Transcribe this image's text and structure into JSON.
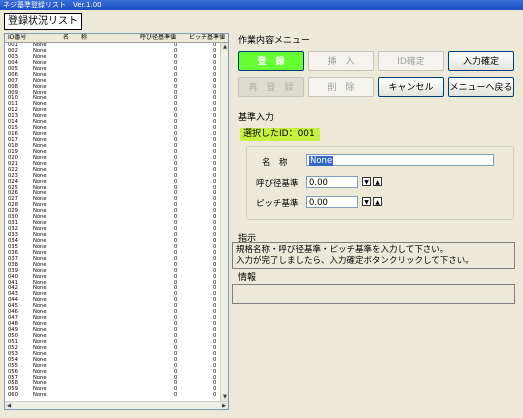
{
  "window": {
    "title": "ネジ基準登録リスト　Ver.1.00"
  },
  "list_panel": {
    "title": "登録状況リスト",
    "columns": [
      "ID番号",
      "名　　称",
      "呼び径基準値",
      "ピッチ基準値"
    ],
    "rows": [
      [
        "001",
        "None",
        "0",
        "0"
      ],
      [
        "002",
        "None",
        "0",
        "0"
      ],
      [
        "003",
        "None",
        "0",
        "0"
      ],
      [
        "004",
        "None",
        "0",
        "0"
      ],
      [
        "005",
        "None",
        "0",
        "0"
      ],
      [
        "006",
        "None",
        "0",
        "0"
      ],
      [
        "007",
        "None",
        "0",
        "0"
      ],
      [
        "008",
        "None",
        "0",
        "0"
      ],
      [
        "009",
        "None",
        "0",
        "0"
      ],
      [
        "010",
        "None",
        "0",
        "0"
      ],
      [
        "011",
        "None",
        "0",
        "0"
      ],
      [
        "012",
        "None",
        "0",
        "0"
      ],
      [
        "013",
        "None",
        "0",
        "0"
      ],
      [
        "014",
        "None",
        "0",
        "0"
      ],
      [
        "015",
        "None",
        "0",
        "0"
      ],
      [
        "016",
        "None",
        "0",
        "0"
      ],
      [
        "017",
        "None",
        "0",
        "0"
      ],
      [
        "018",
        "None",
        "0",
        "0"
      ],
      [
        "019",
        "None",
        "0",
        "0"
      ],
      [
        "020",
        "None",
        "0",
        "0"
      ],
      [
        "021",
        "None",
        "0",
        "0"
      ],
      [
        "022",
        "None",
        "0",
        "0"
      ],
      [
        "023",
        "None",
        "0",
        "0"
      ],
      [
        "024",
        "None",
        "0",
        "0"
      ],
      [
        "025",
        "None",
        "0",
        "0"
      ],
      [
        "026",
        "None",
        "0",
        "0"
      ],
      [
        "027",
        "None",
        "0",
        "0"
      ],
      [
        "028",
        "None",
        "0",
        "0"
      ],
      [
        "029",
        "None",
        "0",
        "0"
      ],
      [
        "030",
        "None",
        "0",
        "0"
      ],
      [
        "031",
        "None",
        "0",
        "0"
      ],
      [
        "032",
        "None",
        "0",
        "0"
      ],
      [
        "033",
        "None",
        "0",
        "0"
      ],
      [
        "034",
        "None",
        "0",
        "0"
      ],
      [
        "035",
        "None",
        "0",
        "0"
      ],
      [
        "036",
        "None",
        "0",
        "0"
      ],
      [
        "037",
        "None",
        "0",
        "0"
      ],
      [
        "038",
        "None",
        "0",
        "0"
      ],
      [
        "039",
        "None",
        "0",
        "0"
      ],
      [
        "040",
        "None",
        "0",
        "0"
      ],
      [
        "041",
        "None",
        "0",
        "0"
      ],
      [
        "042",
        "None",
        "0",
        "0"
      ],
      [
        "043",
        "None",
        "0",
        "0"
      ],
      [
        "044",
        "None",
        "0",
        "0"
      ],
      [
        "045",
        "None",
        "0",
        "0"
      ],
      [
        "046",
        "None",
        "0",
        "0"
      ],
      [
        "047",
        "None",
        "0",
        "0"
      ],
      [
        "048",
        "None",
        "0",
        "0"
      ],
      [
        "049",
        "None",
        "0",
        "0"
      ],
      [
        "050",
        "None",
        "0",
        "0"
      ],
      [
        "051",
        "None",
        "0",
        "0"
      ],
      [
        "052",
        "None",
        "0",
        "0"
      ],
      [
        "053",
        "None",
        "0",
        "0"
      ],
      [
        "054",
        "None",
        "0",
        "0"
      ],
      [
        "055",
        "None",
        "0",
        "0"
      ],
      [
        "056",
        "None",
        "0",
        "0"
      ],
      [
        "057",
        "None",
        "0",
        "0"
      ],
      [
        "058",
        "None",
        "0",
        "0"
      ],
      [
        "059",
        "None",
        "0",
        "0"
      ],
      [
        "060",
        "None",
        "0",
        "0"
      ]
    ]
  },
  "menu": {
    "title": "作業内容メニュー",
    "register": "登　録",
    "insert": "挿　入",
    "confirm_id": "ID確定",
    "confirm_input": "入力確定",
    "reregister": "再　登　録",
    "delete": "削　除",
    "cancel": "キャンセル",
    "back_to_menu": "メニューへ戻る"
  },
  "standard_input": {
    "title": "基準入力",
    "selected_id": "選択したID：001",
    "name_label": "名　称",
    "name_value": "None",
    "nominal_label": "呼び径基準",
    "nominal_value": "0.00",
    "pitch_label": "ピッチ基準",
    "pitch_value": "0.00"
  },
  "instructions": {
    "title": "指示",
    "line1": "規格名称・呼び径基準・ピッチ基準を入力して下さい。",
    "line2": "入力が完了しましたら、入力確定ボタンクリックして下さい。"
  },
  "info": {
    "title": "情報",
    "text": ""
  },
  "colors": {
    "register_button": "#66ff33",
    "selected_id_bg": "#c8f040",
    "selection": "#316ac5"
  }
}
